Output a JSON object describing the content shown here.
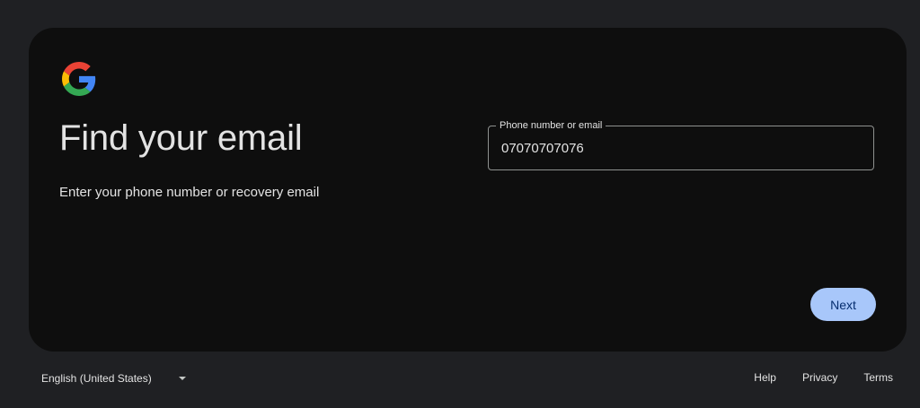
{
  "brand": {
    "logo_icon": "google-g-logo",
    "colors": {
      "blue": "#4285F4",
      "red": "#EA4335",
      "yellow": "#FBBC05",
      "green": "#34A853"
    }
  },
  "main": {
    "title": "Find your email",
    "subtitle": "Enter your phone number or recovery email"
  },
  "form": {
    "field_label": "Phone number or email",
    "field_value": "07070707076"
  },
  "actions": {
    "next_label": "Next",
    "next_color": "#a8c7fa"
  },
  "footer": {
    "language": "English (United States)",
    "links": [
      "Help",
      "Privacy",
      "Terms"
    ]
  }
}
